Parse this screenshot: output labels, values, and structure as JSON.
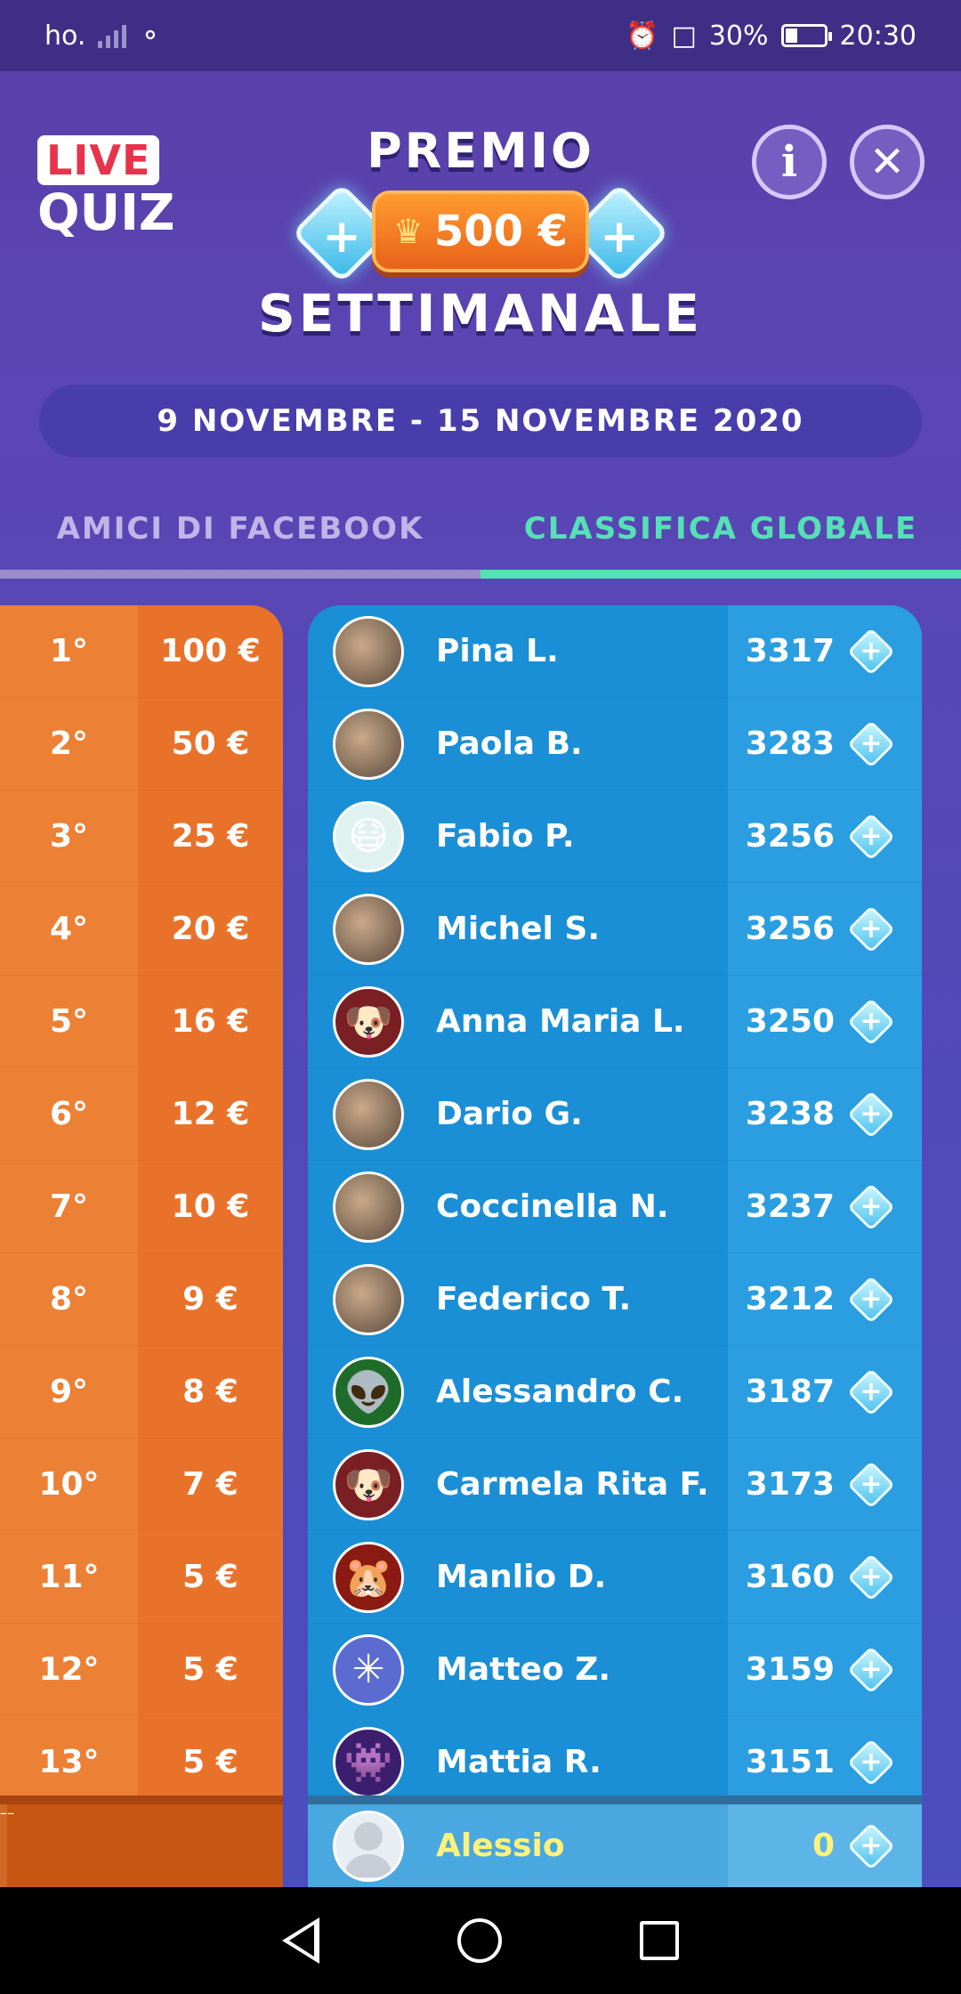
{
  "status_bar": {
    "carrier": "ho.",
    "battery": "30%",
    "time": "20:30"
  },
  "logo": {
    "live": "LIVE",
    "quiz": "QUIZ"
  },
  "banner": {
    "title_top": "PREMIO",
    "prize": "500 €",
    "title_bottom": "SETTIMANALE"
  },
  "buttons": {
    "info": "i",
    "close": "✕"
  },
  "date_range": "9 NOVEMBRE - 15 NOVEMBRE 2020",
  "tabs": [
    {
      "label": "AMICI DI FACEBOOK",
      "active": false
    },
    {
      "label": "CLASSIFICA GLOBALE",
      "active": true
    }
  ],
  "prizes": [
    {
      "rank": "1°",
      "amount": "100 €"
    },
    {
      "rank": "2°",
      "amount": "50 €"
    },
    {
      "rank": "3°",
      "amount": "25 €"
    },
    {
      "rank": "4°",
      "amount": "20 €"
    },
    {
      "rank": "5°",
      "amount": "16 €"
    },
    {
      "rank": "6°",
      "amount": "12 €"
    },
    {
      "rank": "7°",
      "amount": "10 €"
    },
    {
      "rank": "8°",
      "amount": "9 €"
    },
    {
      "rank": "9°",
      "amount": "8 €"
    },
    {
      "rank": "10°",
      "amount": "7 €"
    },
    {
      "rank": "11°",
      "amount": "5 €"
    },
    {
      "rank": "12°",
      "amount": "5 €"
    },
    {
      "rank": "13°",
      "amount": "5 €"
    }
  ],
  "leaderboard": [
    {
      "name": "Pina L.",
      "score": "3317",
      "avatar": "photo-avatar"
    },
    {
      "name": "Paola B.",
      "score": "3283",
      "avatar": "photo-avatar"
    },
    {
      "name": "Fabio P.",
      "score": "3256",
      "avatar": "masked-face-avatar"
    },
    {
      "name": "Michel S.",
      "score": "3256",
      "avatar": "photo-avatar"
    },
    {
      "name": "Anna Maria L.",
      "score": "3250",
      "avatar": "dog-avatar"
    },
    {
      "name": "Dario G.",
      "score": "3238",
      "avatar": "photo-avatar"
    },
    {
      "name": "Coccinella N.",
      "score": "3237",
      "avatar": "photo-avatar"
    },
    {
      "name": "Federico T.",
      "score": "3212",
      "avatar": "photo-avatar"
    },
    {
      "name": "Alessandro C.",
      "score": "3187",
      "avatar": "alien-avatar"
    },
    {
      "name": "Carmela Rita F.",
      "score": "3173",
      "avatar": "dog-avatar"
    },
    {
      "name": "Manlio D.",
      "score": "3160",
      "avatar": "hamster-avatar"
    },
    {
      "name": "Matteo Z.",
      "score": "3159",
      "avatar": "loading-avatar"
    },
    {
      "name": "Mattia R.",
      "score": "3151",
      "avatar": "space-invader-avatar"
    }
  ],
  "me": {
    "rank": "–",
    "amount": "–",
    "name": "Alessio",
    "score": "0",
    "avatar": "default-user-avatar"
  },
  "colors": {
    "accent_green": "#55e0b5",
    "prize_orange": "#e9722a",
    "board_blue": "#1a8fd6",
    "me_name": "#fff27a"
  }
}
